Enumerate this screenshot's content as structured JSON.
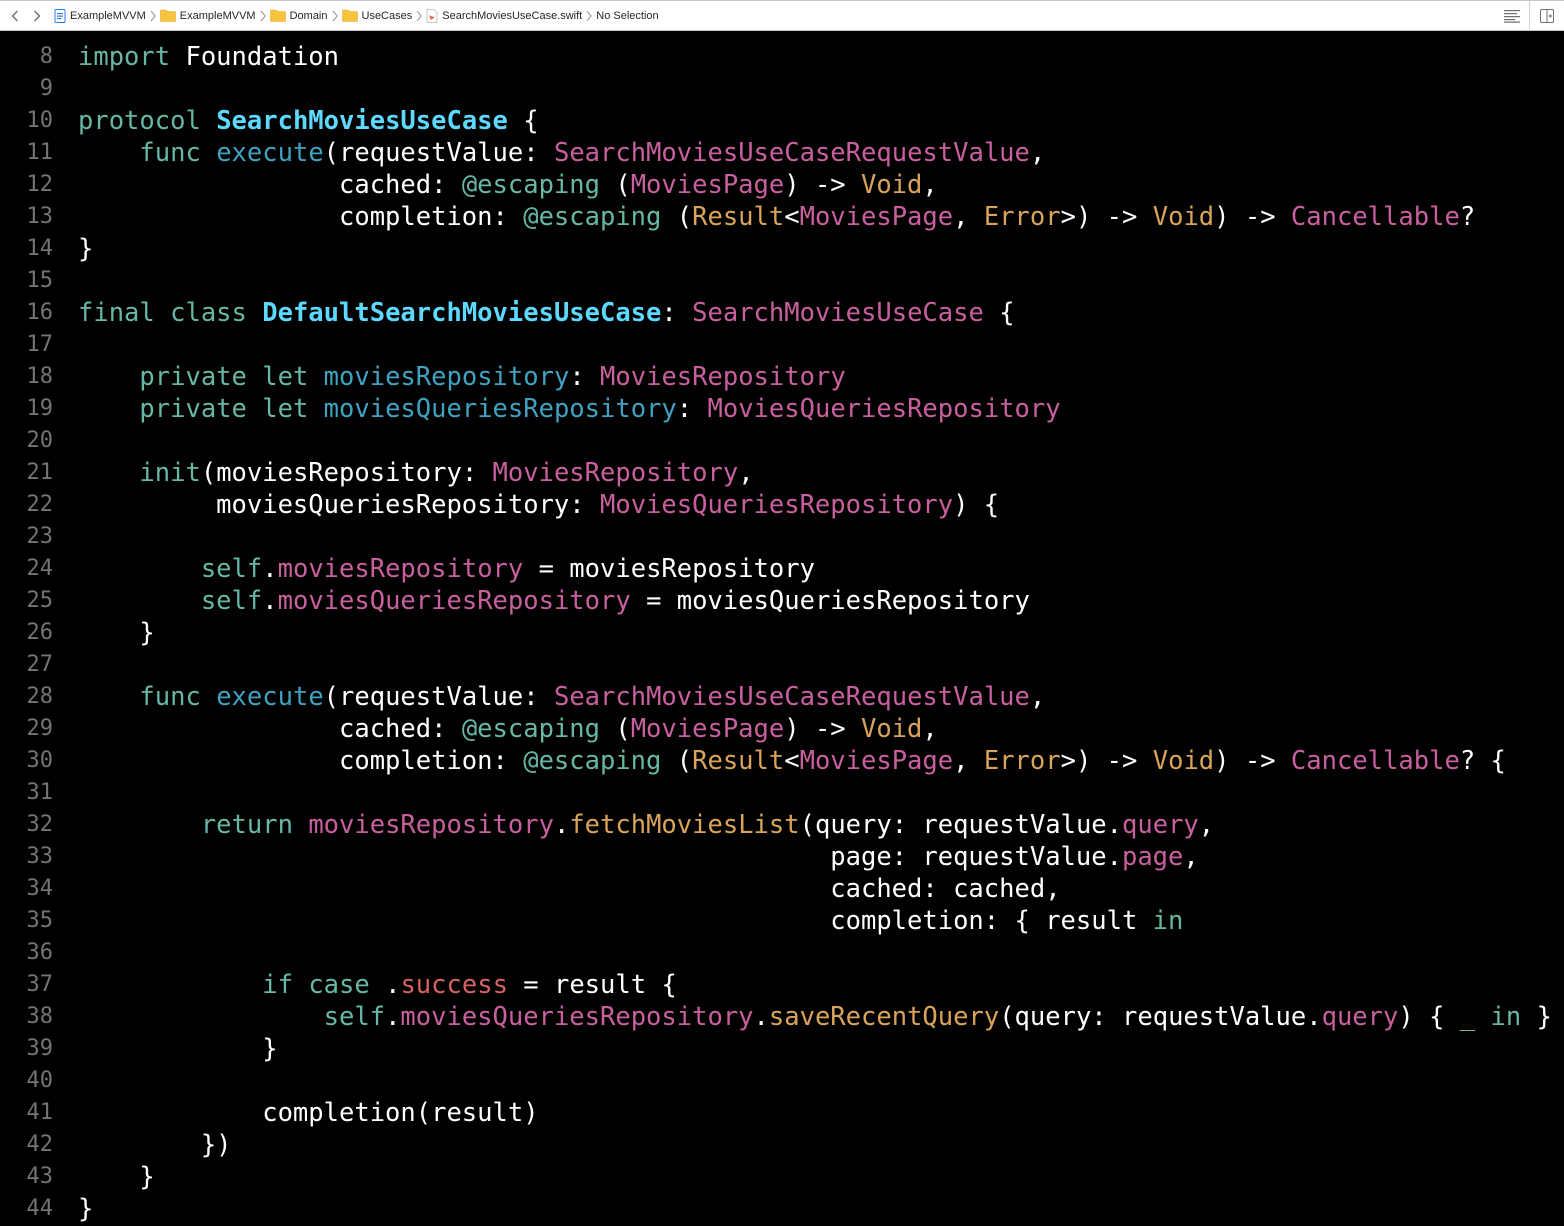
{
  "jumpbar": {
    "crumbs": [
      {
        "label": "ExampleMVVM",
        "icon": "project-file-icon"
      },
      {
        "label": "ExampleMVVM",
        "icon": "folder-icon"
      },
      {
        "label": "Domain",
        "icon": "folder-icon"
      },
      {
        "label": "UseCases",
        "icon": "folder-icon"
      },
      {
        "label": "SearchMoviesUseCase.swift",
        "icon": "swift-file-icon"
      },
      {
        "label": "No Selection",
        "icon": ""
      }
    ],
    "colors": {
      "folder": "#f8c440",
      "project": "#2f7fe0",
      "swift": "#e9593b"
    }
  },
  "editor": {
    "colors": {
      "background": "#000000",
      "plain": "#ffffff",
      "keyword": "#67b7a4",
      "declaration": "#5dd8ff",
      "function": "#41a1c0",
      "project_type": "#c8609f",
      "system_type": "#d9a45a",
      "line_number": "#747478"
    },
    "lines": [
      {
        "n": "8",
        "t": [
          [
            "kw",
            "import"
          ],
          [
            "pl",
            " Foundation"
          ]
        ]
      },
      {
        "n": "9",
        "t": []
      },
      {
        "n": "10",
        "t": [
          [
            "kw",
            "protocol"
          ],
          [
            "pl",
            " "
          ],
          [
            "dec",
            "SearchMoviesUseCase"
          ],
          [
            "pl",
            " {"
          ]
        ]
      },
      {
        "n": "11",
        "t": [
          [
            "pl",
            "    "
          ],
          [
            "kw",
            "func"
          ],
          [
            "pl",
            " "
          ],
          [
            "func",
            "execute"
          ],
          [
            "pl",
            "(requestValue: "
          ],
          [
            "repoType",
            "SearchMoviesUseCaseRequestValue"
          ],
          [
            "pl",
            ","
          ]
        ]
      },
      {
        "n": "12",
        "t": [
          [
            "pl",
            "                 cached: "
          ],
          [
            "kw",
            "@escaping"
          ],
          [
            "pl",
            " ("
          ],
          [
            "repoType",
            "MoviesPage"
          ],
          [
            "pl",
            ") -> "
          ],
          [
            "swiftstd",
            "Void"
          ],
          [
            "pl",
            ","
          ]
        ]
      },
      {
        "n": "13",
        "t": [
          [
            "pl",
            "                 completion: "
          ],
          [
            "kw",
            "@escaping"
          ],
          [
            "pl",
            " ("
          ],
          [
            "swiftstd",
            "Result"
          ],
          [
            "pl",
            "<"
          ],
          [
            "repoType",
            "MoviesPage"
          ],
          [
            "pl",
            ", "
          ],
          [
            "swiftstd",
            "Error"
          ],
          [
            "pl",
            ">) -> "
          ],
          [
            "swiftstd",
            "Void"
          ],
          [
            "pl",
            ") -> "
          ],
          [
            "repoType",
            "Cancellable"
          ],
          [
            "pl",
            "?"
          ]
        ]
      },
      {
        "n": "14",
        "t": [
          [
            "pl",
            "}"
          ]
        ]
      },
      {
        "n": "15",
        "t": []
      },
      {
        "n": "16",
        "t": [
          [
            "kw",
            "final"
          ],
          [
            "pl",
            " "
          ],
          [
            "kw",
            "class"
          ],
          [
            "pl",
            " "
          ],
          [
            "dec",
            "DefaultSearchMoviesUseCase"
          ],
          [
            "pl",
            ": "
          ],
          [
            "repoType",
            "SearchMoviesUseCase"
          ],
          [
            "pl",
            " {"
          ]
        ]
      },
      {
        "n": "17",
        "t": []
      },
      {
        "n": "18",
        "t": [
          [
            "pl",
            "    "
          ],
          [
            "kw",
            "private"
          ],
          [
            "pl",
            " "
          ],
          [
            "kw",
            "let"
          ],
          [
            "pl",
            " "
          ],
          [
            "func",
            "moviesRepository"
          ],
          [
            "pl",
            ": "
          ],
          [
            "repoType",
            "MoviesRepository"
          ]
        ]
      },
      {
        "n": "19",
        "t": [
          [
            "pl",
            "    "
          ],
          [
            "kw",
            "private"
          ],
          [
            "pl",
            " "
          ],
          [
            "kw",
            "let"
          ],
          [
            "pl",
            " "
          ],
          [
            "func",
            "moviesQueriesRepository"
          ],
          [
            "pl",
            ": "
          ],
          [
            "repoType",
            "MoviesQueriesRepository"
          ]
        ]
      },
      {
        "n": "20",
        "t": []
      },
      {
        "n": "21",
        "t": [
          [
            "pl",
            "    "
          ],
          [
            "kw",
            "init"
          ],
          [
            "pl",
            "(moviesRepository: "
          ],
          [
            "repoType",
            "MoviesRepository"
          ],
          [
            "pl",
            ","
          ]
        ]
      },
      {
        "n": "22",
        "t": [
          [
            "pl",
            "         moviesQueriesRepository: "
          ],
          [
            "repoType",
            "MoviesQueriesRepository"
          ],
          [
            "pl",
            ") {"
          ]
        ]
      },
      {
        "n": "23",
        "t": []
      },
      {
        "n": "24",
        "t": [
          [
            "pl",
            "        "
          ],
          [
            "kw",
            "self"
          ],
          [
            "pl",
            "."
          ],
          [
            "repoType",
            "moviesRepository"
          ],
          [
            "pl",
            " = moviesRepository"
          ]
        ]
      },
      {
        "n": "25",
        "t": [
          [
            "pl",
            "        "
          ],
          [
            "kw",
            "self"
          ],
          [
            "pl",
            "."
          ],
          [
            "repoType",
            "moviesQueriesRepository"
          ],
          [
            "pl",
            " = moviesQueriesRepository"
          ]
        ]
      },
      {
        "n": "26",
        "t": [
          [
            "pl",
            "    }"
          ]
        ]
      },
      {
        "n": "27",
        "t": []
      },
      {
        "n": "28",
        "t": [
          [
            "pl",
            "    "
          ],
          [
            "kw",
            "func"
          ],
          [
            "pl",
            " "
          ],
          [
            "func",
            "execute"
          ],
          [
            "pl",
            "(requestValue: "
          ],
          [
            "repoType",
            "SearchMoviesUseCaseRequestValue"
          ],
          [
            "pl",
            ","
          ]
        ]
      },
      {
        "n": "29",
        "t": [
          [
            "pl",
            "                 cached: "
          ],
          [
            "kw",
            "@escaping"
          ],
          [
            "pl",
            " ("
          ],
          [
            "repoType",
            "MoviesPage"
          ],
          [
            "pl",
            ") -> "
          ],
          [
            "swiftstd",
            "Void"
          ],
          [
            "pl",
            ","
          ]
        ]
      },
      {
        "n": "30",
        "t": [
          [
            "pl",
            "                 completion: "
          ],
          [
            "kw",
            "@escaping"
          ],
          [
            "pl",
            " ("
          ],
          [
            "swiftstd",
            "Result"
          ],
          [
            "pl",
            "<"
          ],
          [
            "repoType",
            "MoviesPage"
          ],
          [
            "pl",
            ", "
          ],
          [
            "swiftstd",
            "Error"
          ],
          [
            "pl",
            ">) -> "
          ],
          [
            "swiftstd",
            "Void"
          ],
          [
            "pl",
            ") -> "
          ],
          [
            "repoType",
            "Cancellable"
          ],
          [
            "pl",
            "? {"
          ]
        ]
      },
      {
        "n": "31",
        "t": []
      },
      {
        "n": "32",
        "t": [
          [
            "pl",
            "        "
          ],
          [
            "kw",
            "return"
          ],
          [
            "pl",
            " "
          ],
          [
            "repoType",
            "moviesRepository"
          ],
          [
            "pl",
            "."
          ],
          [
            "swiftstd",
            "fetchMoviesList"
          ],
          [
            "pl",
            "(query: requestValue."
          ],
          [
            "repoType",
            "query"
          ],
          [
            "pl",
            ","
          ]
        ]
      },
      {
        "n": "33",
        "t": [
          [
            "pl",
            "                                                 page: requestValue."
          ],
          [
            "repoType",
            "page"
          ],
          [
            "pl",
            ","
          ]
        ]
      },
      {
        "n": "34",
        "t": [
          [
            "pl",
            "                                                 cached: cached,"
          ]
        ]
      },
      {
        "n": "35",
        "t": [
          [
            "pl",
            "                                                 completion: { result "
          ],
          [
            "kw",
            "in"
          ]
        ]
      },
      {
        "n": "36",
        "t": []
      },
      {
        "n": "37",
        "t": [
          [
            "pl",
            "            "
          ],
          [
            "kw",
            "if"
          ],
          [
            "pl",
            " "
          ],
          [
            "kw",
            "case"
          ],
          [
            "pl",
            " ."
          ],
          [
            "case",
            "success"
          ],
          [
            "pl",
            " = result {"
          ]
        ]
      },
      {
        "n": "38",
        "t": [
          [
            "pl",
            "                "
          ],
          [
            "kw",
            "self"
          ],
          [
            "pl",
            "."
          ],
          [
            "repoType",
            "moviesQueriesRepository"
          ],
          [
            "pl",
            "."
          ],
          [
            "swiftstd",
            "saveRecentQuery"
          ],
          [
            "pl",
            "(query: requestValue."
          ],
          [
            "repoType",
            "query"
          ],
          [
            "pl",
            ") { "
          ],
          [
            "kw",
            "_"
          ],
          [
            "pl",
            " "
          ],
          [
            "kw",
            "in"
          ],
          [
            "pl",
            " }"
          ]
        ]
      },
      {
        "n": "39",
        "t": [
          [
            "pl",
            "            }"
          ]
        ]
      },
      {
        "n": "40",
        "t": []
      },
      {
        "n": "41",
        "t": [
          [
            "pl",
            "            completion(result)"
          ]
        ]
      },
      {
        "n": "42",
        "t": [
          [
            "pl",
            "        })"
          ]
        ]
      },
      {
        "n": "43",
        "t": [
          [
            "pl",
            "    }"
          ]
        ]
      },
      {
        "n": "44",
        "t": [
          [
            "pl",
            "}"
          ]
        ]
      }
    ]
  }
}
